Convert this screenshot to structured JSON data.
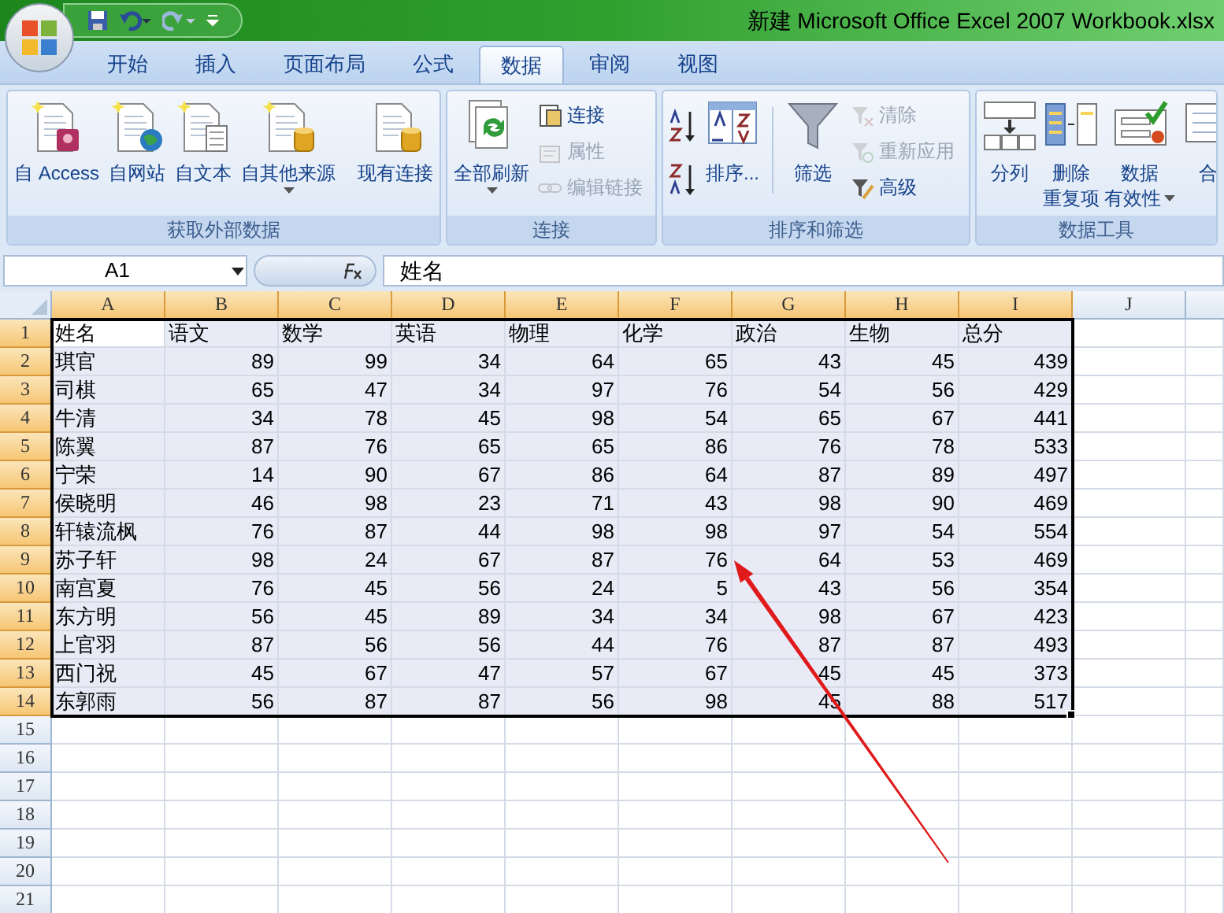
{
  "window": {
    "title": "新建 Microsoft Office Excel 2007 Workbook.xlsx"
  },
  "tabs": [
    {
      "label": "开始",
      "selected": false
    },
    {
      "label": "插入",
      "selected": false
    },
    {
      "label": "页面布局",
      "selected": false
    },
    {
      "label": "公式",
      "selected": false
    },
    {
      "label": "数据",
      "selected": true
    },
    {
      "label": "审阅",
      "selected": false
    },
    {
      "label": "视图",
      "selected": false
    }
  ],
  "ribbon": {
    "groups": [
      {
        "title": "获取外部数据",
        "items": [
          {
            "kind": "large",
            "label": "自 Access",
            "dropdown": false
          },
          {
            "kind": "large",
            "label": "自网站",
            "dropdown": false
          },
          {
            "kind": "large",
            "label": "自文本",
            "dropdown": false
          },
          {
            "kind": "large",
            "label": "自其他来源",
            "dropdown": true
          },
          {
            "kind": "separator"
          },
          {
            "kind": "large",
            "label": "现有连接",
            "dropdown": false
          }
        ]
      },
      {
        "title": "连接",
        "items": [
          {
            "kind": "large",
            "label": "全部刷新",
            "dropdown": true
          },
          {
            "kind": "small",
            "label": "连接",
            "disabled": false
          },
          {
            "kind": "small",
            "label": "属性",
            "disabled": true
          },
          {
            "kind": "small",
            "label": "编辑链接",
            "disabled": true
          }
        ]
      },
      {
        "title": "排序和筛选",
        "items": [
          {
            "kind": "sort_pair"
          },
          {
            "kind": "large",
            "label": "排序...",
            "dropdown": false
          },
          {
            "kind": "separator"
          },
          {
            "kind": "large",
            "label": "筛选",
            "dropdown": false
          },
          {
            "kind": "small",
            "label": "清除",
            "disabled": true
          },
          {
            "kind": "small",
            "label": "重新应用",
            "disabled": true
          },
          {
            "kind": "small",
            "label": "高级",
            "disabled": false
          }
        ]
      },
      {
        "title": "数据工具",
        "items": [
          {
            "kind": "large",
            "label": "分列",
            "dropdown": false
          },
          {
            "kind": "large",
            "label": "删除",
            "label_2": "重复项",
            "dropdown": false
          },
          {
            "kind": "large",
            "label": "数据",
            "label_2": "有效性",
            "dropdown": true
          },
          {
            "kind": "large",
            "label": "合",
            "dropdown": false
          }
        ]
      }
    ]
  },
  "formula_bar": {
    "name_box": "A1",
    "formula": "姓名"
  },
  "sheet": {
    "columns": [
      {
        "label": "A",
        "selected": true
      },
      {
        "label": "B",
        "selected": true
      },
      {
        "label": "C",
        "selected": true
      },
      {
        "label": "D",
        "selected": true
      },
      {
        "label": "E",
        "selected": true
      },
      {
        "label": "F",
        "selected": true
      },
      {
        "label": "G",
        "selected": true
      },
      {
        "label": "H",
        "selected": true
      },
      {
        "label": "I",
        "selected": true
      },
      {
        "label": "J",
        "selected": false
      }
    ],
    "rows": [
      {
        "header": "1",
        "selected": true,
        "kind": "heading",
        "cells": [
          "姓名",
          "语文",
          "数学",
          "英语",
          "物理",
          "化学",
          "政治",
          "生物",
          "总分"
        ]
      },
      {
        "header": "2",
        "selected": true,
        "kind": "data",
        "cells": [
          "琪官",
          "89",
          "99",
          "34",
          "64",
          "65",
          "43",
          "45",
          "439"
        ]
      },
      {
        "header": "3",
        "selected": true,
        "kind": "data",
        "cells": [
          "司棋",
          "65",
          "47",
          "34",
          "97",
          "76",
          "54",
          "56",
          "429"
        ]
      },
      {
        "header": "4",
        "selected": true,
        "kind": "data",
        "cells": [
          "牛清",
          "34",
          "78",
          "45",
          "98",
          "54",
          "65",
          "67",
          "441"
        ]
      },
      {
        "header": "5",
        "selected": true,
        "kind": "data",
        "cells": [
          "陈翼",
          "87",
          "76",
          "65",
          "65",
          "86",
          "76",
          "78",
          "533"
        ]
      },
      {
        "header": "6",
        "selected": true,
        "kind": "data",
        "cells": [
          "宁荣",
          "14",
          "90",
          "67",
          "86",
          "64",
          "87",
          "89",
          "497"
        ]
      },
      {
        "header": "7",
        "selected": true,
        "kind": "data",
        "cells": [
          "侯晓明",
          "46",
          "98",
          "23",
          "71",
          "43",
          "98",
          "90",
          "469"
        ]
      },
      {
        "header": "8",
        "selected": true,
        "kind": "data",
        "cells": [
          "轩辕流枫",
          "76",
          "87",
          "44",
          "98",
          "98",
          "97",
          "54",
          "554"
        ]
      },
      {
        "header": "9",
        "selected": true,
        "kind": "data",
        "cells": [
          "苏子轩",
          "98",
          "24",
          "67",
          "87",
          "76",
          "64",
          "53",
          "469"
        ]
      },
      {
        "header": "10",
        "selected": true,
        "kind": "data",
        "cells": [
          "南宫夏",
          "76",
          "45",
          "56",
          "24",
          "5",
          "43",
          "56",
          "354"
        ]
      },
      {
        "header": "11",
        "selected": true,
        "kind": "data",
        "cells": [
          "东方明",
          "56",
          "45",
          "89",
          "34",
          "34",
          "98",
          "67",
          "423"
        ]
      },
      {
        "header": "12",
        "selected": true,
        "kind": "data",
        "cells": [
          "上官羽",
          "87",
          "56",
          "56",
          "44",
          "76",
          "87",
          "87",
          "493"
        ]
      },
      {
        "header": "13",
        "selected": true,
        "kind": "data",
        "cells": [
          "西门祝",
          "45",
          "67",
          "47",
          "57",
          "67",
          "45",
          "45",
          "373"
        ]
      },
      {
        "header": "14",
        "selected": true,
        "kind": "data",
        "cells": [
          "东郭雨",
          "56",
          "87",
          "87",
          "56",
          "98",
          "45",
          "88",
          "517"
        ]
      },
      {
        "header": "15",
        "selected": false,
        "kind": "empty"
      },
      {
        "header": "16",
        "selected": false,
        "kind": "empty"
      },
      {
        "header": "17",
        "selected": false,
        "kind": "empty"
      },
      {
        "header": "18",
        "selected": false,
        "kind": "empty"
      },
      {
        "header": "19",
        "selected": false,
        "kind": "empty"
      },
      {
        "header": "20",
        "selected": false,
        "kind": "empty"
      },
      {
        "header": "21",
        "selected": false,
        "kind": "empty"
      }
    ]
  }
}
